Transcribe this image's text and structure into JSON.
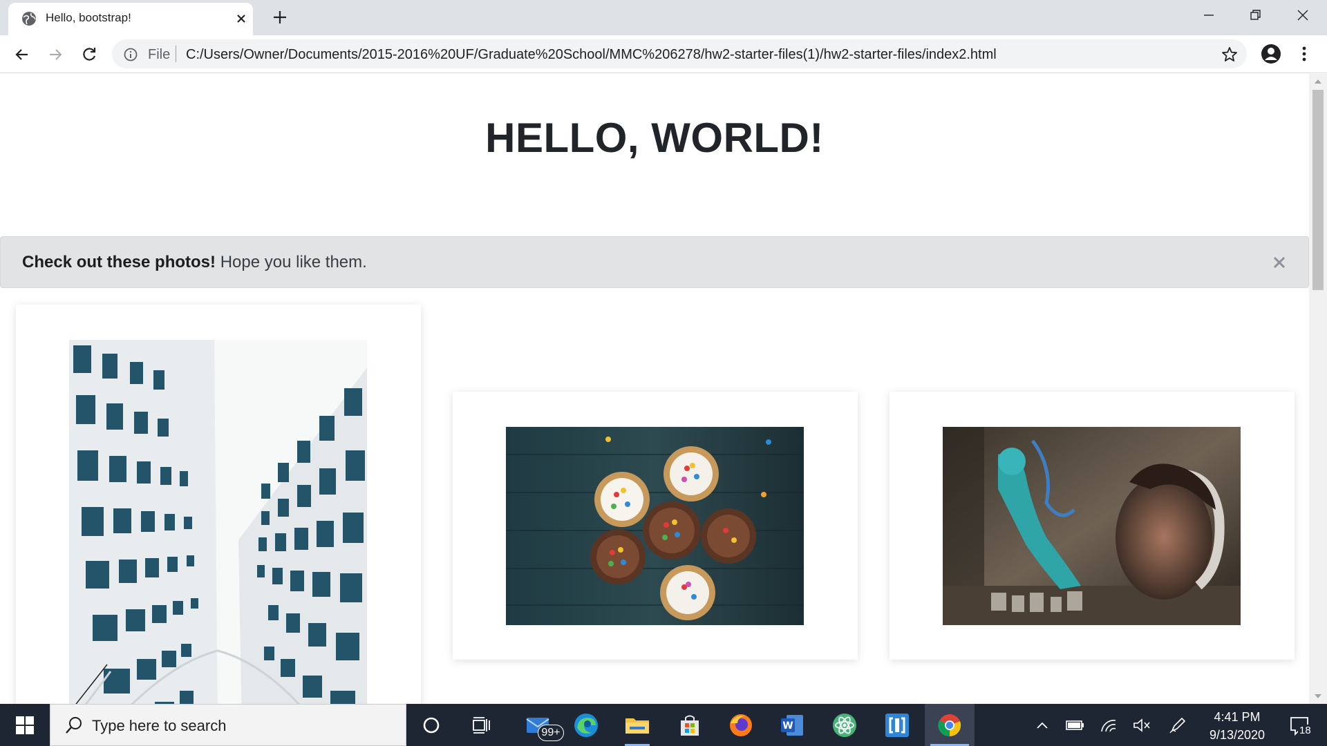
{
  "browser": {
    "tab_title": "Hello, bootstrap!",
    "omnibox": {
      "scheme_label": "File",
      "url": "C:/Users/Owner/Documents/2015-2016%20UF/Graduate%20School/MMC%206278/hw2-starter-files(1)/hw2-starter-files/index2.html"
    }
  },
  "page": {
    "heading": "HELLO, WORLD!",
    "alert": {
      "strong": "Check out these photos!",
      "text": " Hope you like them."
    },
    "cards": [
      {
        "photo_icon": "building-photo"
      },
      {
        "photo_icon": "cupcakes-photo"
      },
      {
        "photo_icon": "graffiti-photo"
      }
    ]
  },
  "taskbar": {
    "search_placeholder": "Type here to search",
    "mail_badge": "99+",
    "time": "4:41 PM",
    "date": "9/13/2020",
    "notification_count": "18"
  },
  "colors": {
    "tabstrip": "#dee1e6",
    "alert_bg": "#e2e3e5",
    "taskbar": "#1f2633",
    "accent": "#8ab4f8"
  }
}
